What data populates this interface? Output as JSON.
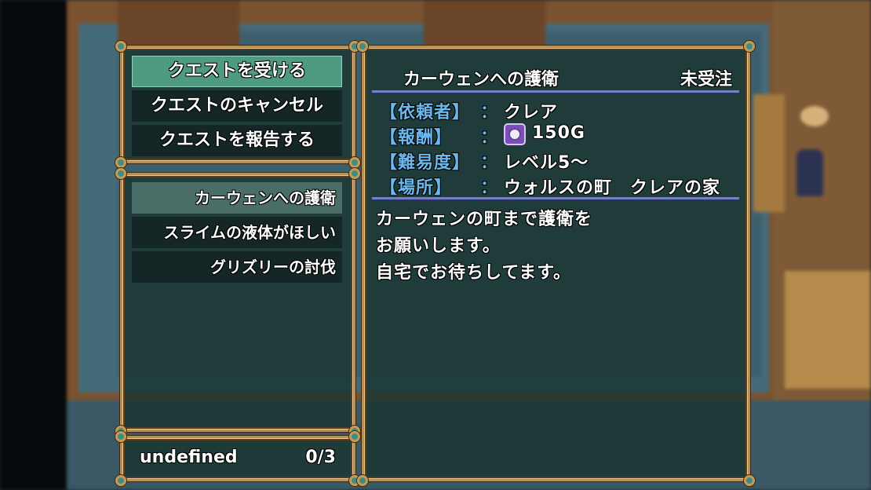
{
  "commands": [
    {
      "label": "クエストを受ける",
      "selected": true
    },
    {
      "label": "クエストのキャンセル",
      "selected": false
    },
    {
      "label": "クエストを報告する",
      "selected": false
    }
  ],
  "quests": [
    {
      "label": "カーウェンへの護衛",
      "selected": true
    },
    {
      "label": "スライムの液体がほしい",
      "selected": false
    },
    {
      "label": "グリズリーの討伐",
      "selected": false
    }
  ],
  "counter": {
    "label": "undefined",
    "value": "0/3"
  },
  "detail": {
    "title": "カーウェンへの護衛",
    "status": "未受注",
    "client_label": "【依頼者】",
    "client_value": "クレア",
    "reward_label": "【報酬】",
    "reward_value": "150G",
    "reward_icon": "coin-icon",
    "difficulty_label": "【難易度】",
    "difficulty_value": "レベル5～",
    "location_label": "【場所】",
    "location_value": "ウォルスの町　クレアの家",
    "colon": "：",
    "description": [
      "カーウェンの町まで護衛を",
      "お願いします。",
      "自宅でお待ちしてます。"
    ]
  },
  "colors": {
    "frame": "#b88e52",
    "window_bg": "#183430",
    "selected": "#4e9a82",
    "label_blue": "#6cb8ee",
    "rule": "#6f7fd8"
  }
}
